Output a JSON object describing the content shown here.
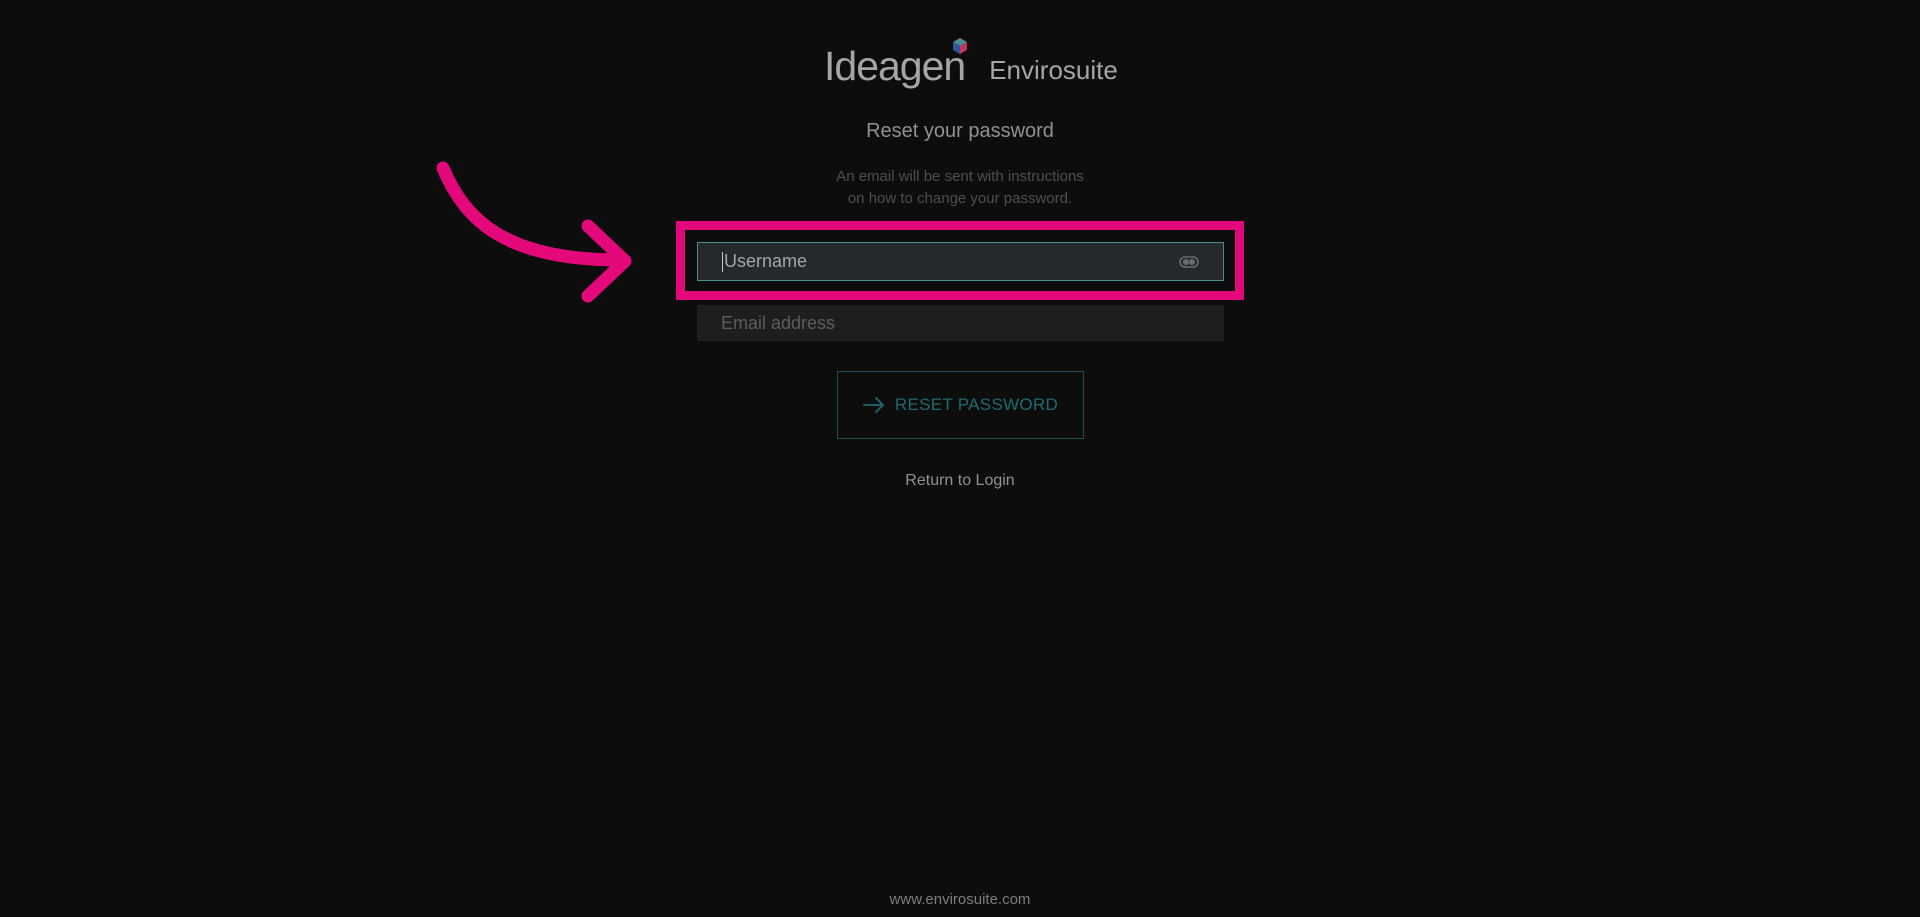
{
  "brand": {
    "primary": "Ideagen",
    "secondary": "Envirosuite"
  },
  "form": {
    "title": "Reset your password",
    "instructions_line1": "An email will be sent with instructions",
    "instructions_line2": "on how to change your password.",
    "username_placeholder": "Username",
    "email_placeholder": "Email address",
    "submit_label": "RESET PASSWORD",
    "return_label": "Return to Login"
  },
  "footer": {
    "url": "www.envirosuite.com"
  },
  "colors": {
    "background": "#0d0d0e",
    "highlight": "#e4097a",
    "accent": "#1f6a6e",
    "focus_border": "#4a8e90"
  },
  "icons": {
    "toggle": "visibility-toggle-icon",
    "submit": "arrow-right-icon",
    "annotation": "curved-arrow-icon"
  }
}
